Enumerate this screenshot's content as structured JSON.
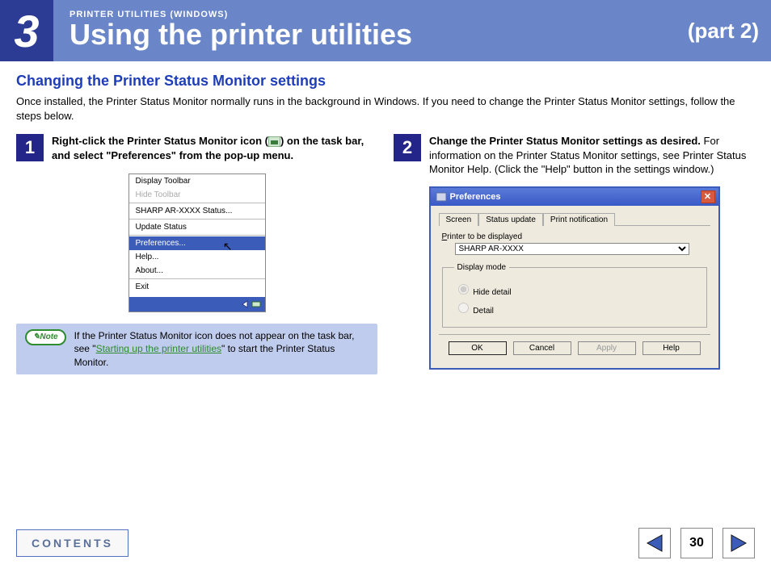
{
  "banner": {
    "chapter": "3",
    "eyebrow": "PRINTER UTILITIES (WINDOWS)",
    "title": "Using the printer utilities",
    "part": "(part 2)"
  },
  "section_title": "Changing the Printer Status Monitor settings",
  "intro": "Once installed, the Printer Status Monitor normally runs in the background in Windows. If you need to change the Printer Status Monitor settings, follow the steps below.",
  "step1": {
    "num": "1",
    "text_a": "Right-click the Printer Status Monitor icon (",
    "text_b": ") on the task bar, and select \"Preferences\" from the pop-up menu.",
    "menu": {
      "display_toolbar": "Display Toolbar",
      "hide_toolbar": "Hide Toolbar",
      "status": "SHARP AR-XXXX Status...",
      "update": "Update Status",
      "preferences": "Preferences...",
      "help": "Help...",
      "about": "About...",
      "exit": "Exit"
    }
  },
  "note": {
    "badge": "Note",
    "pre": "If the Printer Status Monitor icon does not appear on the task bar, see \"",
    "link": "Starting up the printer utilities",
    "post": "\" to start the Printer Status Monitor."
  },
  "step2": {
    "num": "2",
    "bold": "Change the Printer Status Monitor settings as desired.",
    "rest": "For information on the Printer Status Monitor settings, see Printer Status Monitor Help. (Click the \"Help\" button in the settings window.)"
  },
  "prefs": {
    "title": "Preferences",
    "tabs": {
      "screen": "Screen",
      "status": "Status update",
      "print": "Print notification"
    },
    "printer_label_pre": "P",
    "printer_label_post": "rinter to be displayed",
    "printer_value": "SHARP AR-XXXX",
    "displaymode_title": "Display mode",
    "hide_pre": "H",
    "hide_post": "ide detail",
    "detail_pre": "D",
    "detail_post": "etail",
    "buttons": {
      "ok": "OK",
      "cancel": "Cancel",
      "apply": "Apply",
      "help": "Help"
    }
  },
  "nav": {
    "contents": "CONTENTS",
    "page": "30"
  }
}
